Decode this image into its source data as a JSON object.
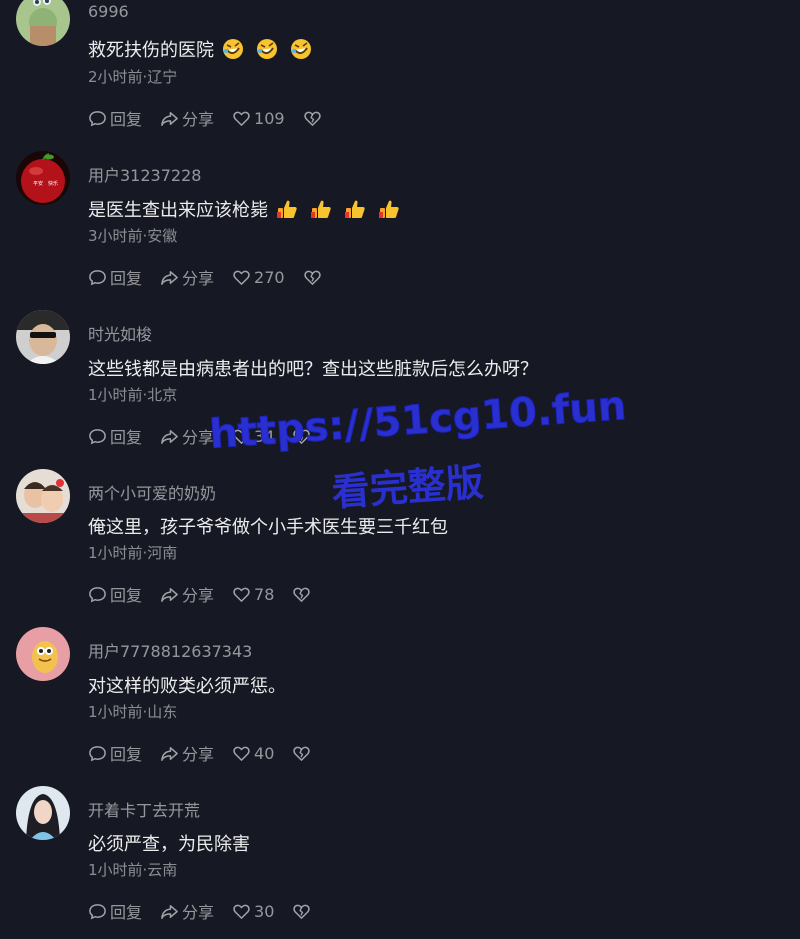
{
  "comments": [
    {
      "username": "6996",
      "content": "救死扶伤的医院",
      "emojis": [
        "rofl-emoji",
        "rofl-emoji",
        "rofl-emoji"
      ],
      "meta": "2小时前·辽宁",
      "reply_label": "回复",
      "share_label": "分享",
      "likes": "109",
      "avatar": "green-cartoon-avatar"
    },
    {
      "username": "用户31237228",
      "content": "是医生查出来应该枪毙",
      "emojis": [
        "thumbs-up-emoji",
        "thumbs-up-emoji",
        "thumbs-up-emoji",
        "thumbs-up-emoji"
      ],
      "meta": "3小时前·安徽",
      "reply_label": "回复",
      "share_label": "分享",
      "likes": "270",
      "avatar": "red-apple-avatar"
    },
    {
      "username": "时光如梭",
      "content": "这些钱都是由病患者出的吧？查出这些脏款后怎么办呀？",
      "emojis": [],
      "meta": "1小时前·北京",
      "reply_label": "回复",
      "share_label": "分享",
      "likes": "34",
      "avatar": "man-sunglasses-avatar"
    },
    {
      "username": "两个小可爱的奶奶",
      "content": "俺这里，孩子爷爷做个小手术医生要三千红包",
      "emojis": [],
      "meta": "1小时前·河南",
      "reply_label": "回复",
      "share_label": "分享",
      "likes": "78",
      "avatar": "children-photo-avatar"
    },
    {
      "username": "用户7778812637343",
      "content": "对这样的败类必须严惩。",
      "emojis": [],
      "meta": "1小时前·山东",
      "reply_label": "回复",
      "share_label": "分享",
      "likes": "40",
      "avatar": "pink-cartoon-avatar"
    },
    {
      "username": "开着卡丁去开荒",
      "content": "必须严查，为民除害",
      "emojis": [],
      "meta": "1小时前·云南",
      "reply_label": "回复",
      "share_label": "分享",
      "likes": "30",
      "avatar": "woman-photo-avatar"
    }
  ],
  "watermark": {
    "line1": "https://51cg10.fun",
    "line2": "看完整版"
  },
  "colors": {
    "background": "#161823",
    "watermark": "#2a2fd0"
  }
}
